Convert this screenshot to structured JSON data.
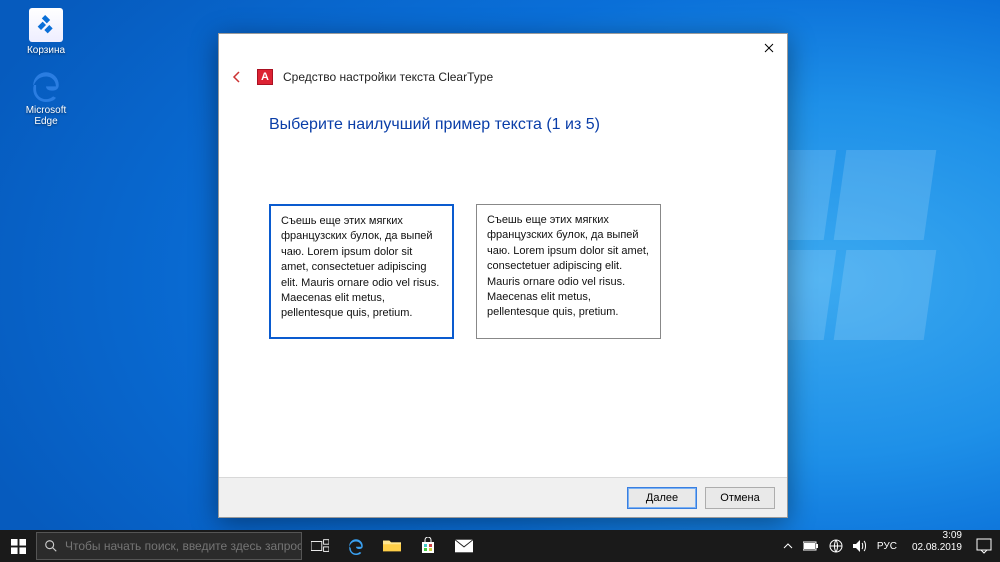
{
  "desktop": {
    "recycle_label": "Корзина",
    "edge_label": "Microsoft Edge"
  },
  "wizard": {
    "app_title": "Средство настройки текста ClearType",
    "heading": "Выберите наилучший пример текста (1 из 5)",
    "sample_text": "Съешь еще этих мягких французских булок, да выпей чаю. Lorem ipsum dolor sit amet, consectetuer adipiscing elit. Mauris ornare odio vel risus. Maecenas elit metus, pellentesque quis, pretium.",
    "btn_next": "Далее",
    "btn_cancel": "Отмена"
  },
  "taskbar": {
    "search_placeholder": "Чтобы начать поиск, введите здесь запрос",
    "lang": "РУС",
    "time": "3:09",
    "date": "02.08.2019"
  }
}
